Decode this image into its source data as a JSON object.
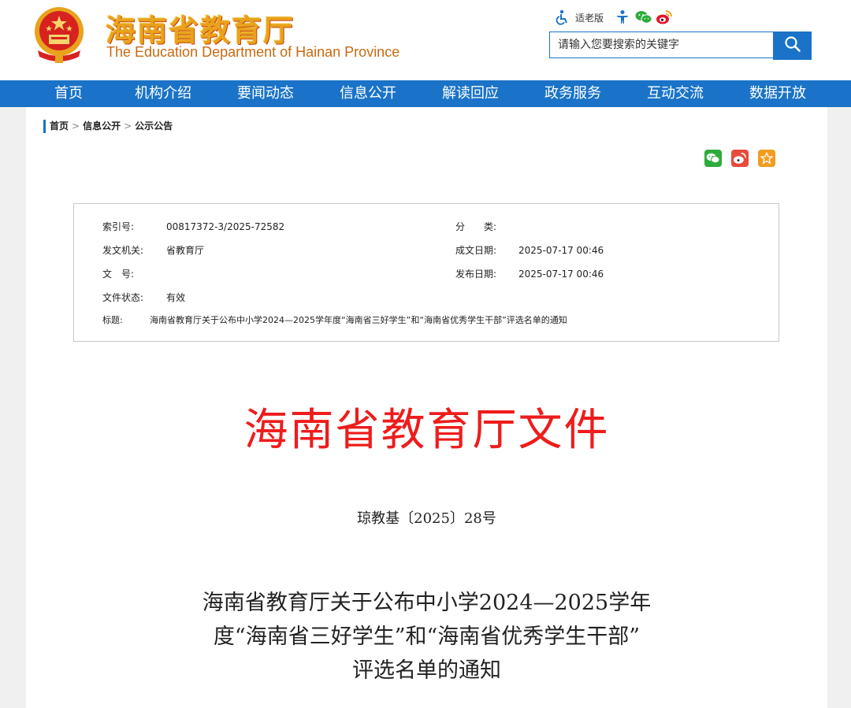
{
  "header": {
    "title_cn": "海南省教育厅",
    "title_en": "The Education Department of Hainan Province",
    "elder_mode_label": "适老版",
    "search_placeholder": "请输入您要搜索的关键字"
  },
  "nav": [
    "首页",
    "机构介绍",
    "要闻动态",
    "信息公开",
    "解读回应",
    "政务服务",
    "互动交流",
    "数据开放"
  ],
  "breadcrumb": [
    "首页",
    "信息公开",
    "公示公告"
  ],
  "breadcrumb_sep": ">",
  "meta": {
    "index_label": "索引号:",
    "index_value": "00817372-3/2025-72582",
    "category_label": "分　　类:",
    "category_value": "",
    "issuer_label": "发文机关:",
    "issuer_value": "省教育厅",
    "created_label": "成文日期:",
    "created_value": "2025-07-17 00:46",
    "docno_label": "文　号:",
    "docno_value": "",
    "published_label": "发布日期:",
    "published_value": "2025-07-17 00:46",
    "status_label": "文件状态:",
    "status_value": "有效",
    "subject_label": "标题:",
    "subject_value": "海南省教育厅关于公布中小学2024—2025学年度“海南省三好学生”和“海南省优秀学生干部”评选名单的通知"
  },
  "document": {
    "header": "海南省教育厅文件",
    "number": "琼教基〔2025〕28号",
    "title_lines": [
      "海南省教育厅关于公布中小学2024—2025学年",
      "度“海南省三好学生”和“海南省优秀学生干部”",
      "评选名单的通知"
    ]
  },
  "colors": {
    "nav_blue": "#1a73c8",
    "doc_red": "#ee1c1c",
    "title_gold": "#e8a21c"
  },
  "icons": {
    "emblem": "national-emblem-icon",
    "elder": "accessibility-icon",
    "app": "person-app-icon",
    "wechat": "wechat-icon",
    "weibo": "weibo-icon",
    "search": "search-icon",
    "favorite": "star-icon"
  }
}
